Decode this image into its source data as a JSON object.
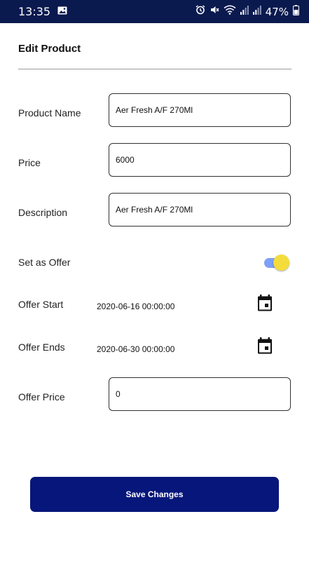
{
  "status_bar": {
    "time": "13:35",
    "battery_percent": "47%",
    "icons": [
      "image-icon",
      "alarm-icon",
      "mute-icon",
      "wifi-icon",
      "signal-icon",
      "signal-icon",
      "battery-icon"
    ]
  },
  "header": {
    "title": "Edit Product"
  },
  "form": {
    "product_name": {
      "label": "Product Name",
      "value": "Aer Fresh A/F 270Ml"
    },
    "price": {
      "label": "Price",
      "value": "6000"
    },
    "description": {
      "label": "Description",
      "value": "Aer Fresh A/F 270Ml"
    },
    "set_as_offer": {
      "label": "Set as Offer",
      "checked": true
    },
    "offer_start": {
      "label": "Offer Start",
      "value": "2020-06-16 00:00:00",
      "icon": "calendar-icon"
    },
    "offer_ends": {
      "label": "Offer Ends",
      "value": "2020-06-30 00:00:00",
      "icon": "calendar-icon"
    },
    "offer_price": {
      "label": "Offer Price",
      "value": "0"
    }
  },
  "actions": {
    "save_label": "Save Changes"
  },
  "colors": {
    "status_bar_bg": "#0a1a4f",
    "save_button_bg": "#07167a",
    "toggle_track": "#7ea0f5",
    "toggle_thumb": "#f3dc3c"
  }
}
